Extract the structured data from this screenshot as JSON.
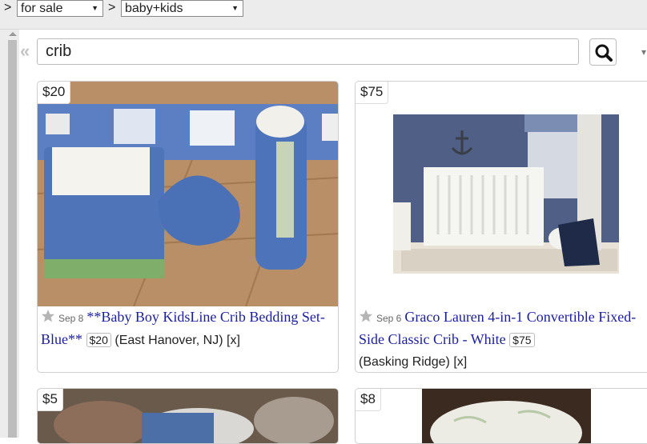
{
  "filters": {
    "sep": ">",
    "type_value": "for sale",
    "category_value": "baby+kids"
  },
  "search": {
    "query": "crib"
  },
  "collapse_glyph": "«",
  "listings": [
    {
      "price": "$20",
      "date": "Sep 8",
      "title": "**Baby Boy KidsLine Crib Bedding Set-Blue**",
      "price_inline": "$20",
      "location": "(East Hanover, NJ)",
      "hide_label": "[x]"
    },
    {
      "price": "$75",
      "date": "Sep 6",
      "title": "Graco Lauren 4-in-1 Convertible Fixed-Side Classic Crib - White",
      "price_inline": "$75",
      "location": "(Basking Ridge)",
      "hide_label": "[x]"
    },
    {
      "price": "$5"
    },
    {
      "price": "$8"
    }
  ],
  "colors": {
    "link": "#1a1fa0",
    "bar_bg": "#ececec"
  }
}
